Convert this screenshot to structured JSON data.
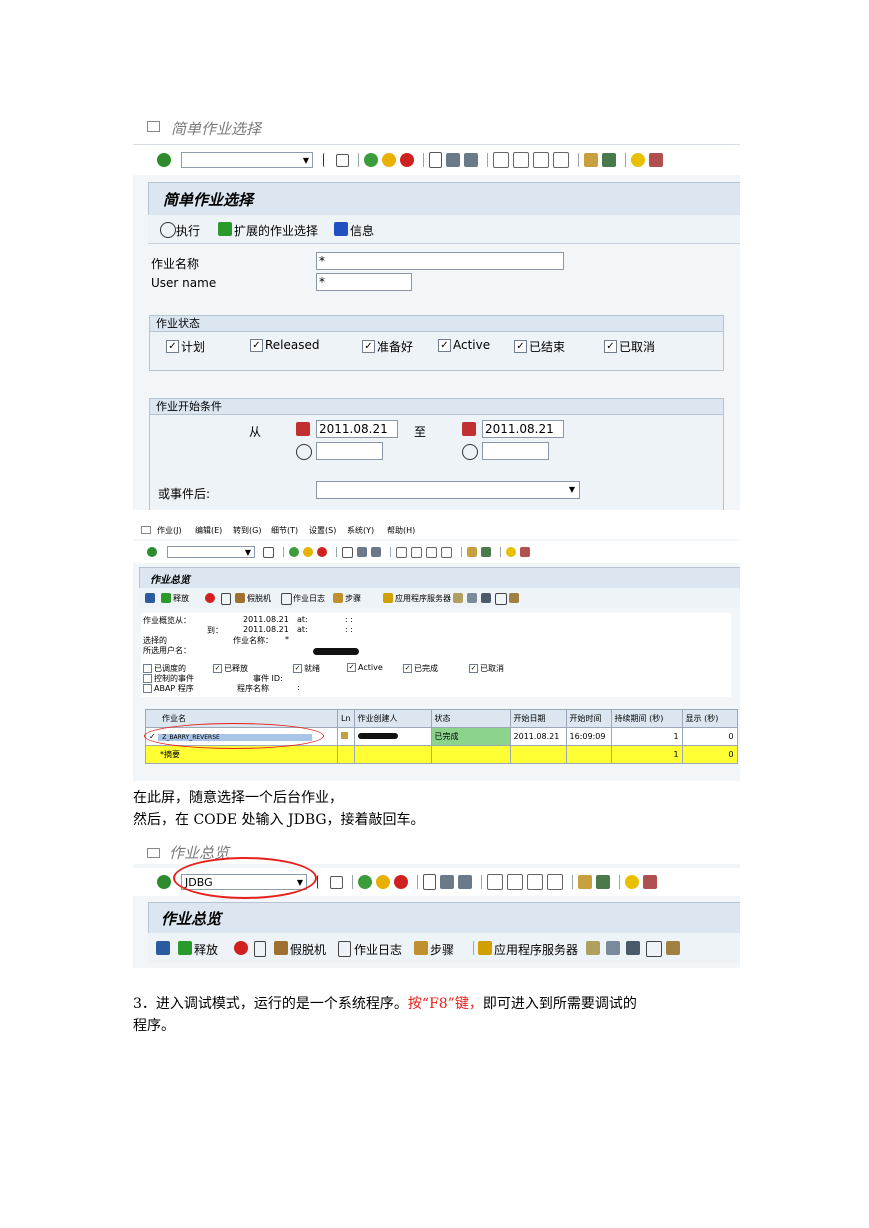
{
  "shot1": {
    "window_title": "简单作业选择",
    "panel_title": "简单作业选择",
    "app_toolbar": {
      "execute": "执行",
      "extended": "扩展的作业选择",
      "info": "信息"
    },
    "fields": {
      "job_name_label": "作业名称",
      "job_name_value": "*",
      "user_label": "User name",
      "user_value": "*"
    },
    "status_group": {
      "title": "作业状态",
      "items": [
        "计划",
        "Released",
        "准备好",
        "Active",
        "已结束",
        "已取消"
      ]
    },
    "start_group": {
      "title": "作业开始条件",
      "from_label": "从",
      "from_date": "2011.08.21",
      "to_label": "至",
      "to_date": "2011.08.21",
      "event_label": "或事件后:"
    }
  },
  "shot2": {
    "menu": [
      "作业(J)",
      "编辑(E)",
      "转到(G)",
      "细节(T)",
      "设置(S)",
      "系统(Y)",
      "帮助(H)"
    ],
    "panel_title": "作业总览",
    "app_toolbar": [
      "释放",
      "假脱机",
      "作业日志",
      "步骤",
      "应用程序服务器"
    ],
    "overview": {
      "from_label": "作业概览从：",
      "from_date": "2011.08.21",
      "at1": "at:",
      "time1": ":  :",
      "to_label": "到：",
      "to_date": "2011.08.21",
      "at2": "at:",
      "time2": ":  :",
      "selected_label": "选择的",
      "job_name_label": "作业名称：",
      "job_name_value": "*",
      "user_label": "所选用户名："
    },
    "checks": {
      "row1": [
        "已调度的",
        "已释放",
        "就绪",
        "Active",
        "已完成",
        "已取消"
      ],
      "row2_label": "控制的事件",
      "event_id_label": "事件 ID:",
      "row3_label": "ABAP 程序",
      "program_label": "程序名称",
      "program_colon": ":"
    },
    "table": {
      "headers": [
        "作业名",
        "Ln",
        "作业创建人",
        "状态",
        "开始日期",
        "开始时间",
        "持续期间 (秒)",
        "显示 (秒)"
      ],
      "row": {
        "check": "✓",
        "job": "Z_BARRY_REVERSE",
        "status": "已完成",
        "date": "2011.08.21",
        "time": "16:09:09",
        "duration": "1",
        "delay": "0"
      },
      "summary": {
        "label": "*摘要",
        "duration": "1",
        "delay": "0"
      }
    }
  },
  "text1": {
    "line1": "在此屏，随意选择一个后台作业，",
    "line2": "然后，在 CODE 处输入 JDBG，接着敲回车。"
  },
  "shot3": {
    "window_title": "作业总览",
    "command_value": "JDBG",
    "panel_title": "作业总览",
    "app_toolbar": [
      "释放",
      "假脱机",
      "作业日志",
      "步骤",
      "应用程序服务器"
    ]
  },
  "text2": {
    "part1": "3．进入调试模式，运行的是一个系统程序。",
    "part2": "按“F8”键，",
    "part3": "即可进入到所需要调试的",
    "line2": "程序。"
  },
  "colors": {
    "accent_red": "#e8221b",
    "status_green": "#8cd48c",
    "summary_yellow": "#ffff33",
    "sap_blue": "#dbe6f1"
  }
}
